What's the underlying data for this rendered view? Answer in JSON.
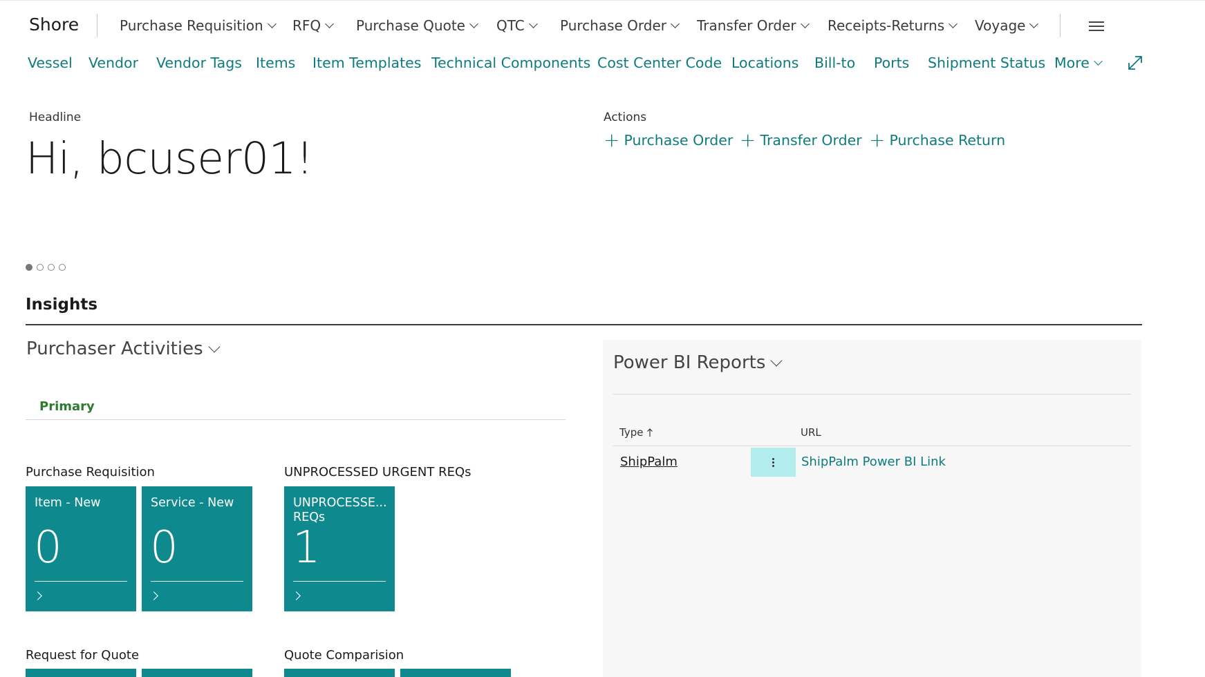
{
  "app": {
    "title": "Shore"
  },
  "nav": {
    "items": [
      {
        "label": "Purchase Requisition"
      },
      {
        "label": "RFQ"
      },
      {
        "label": "Purchase Quote"
      },
      {
        "label": "QTC"
      },
      {
        "label": "Purchase Order"
      },
      {
        "label": "Transfer Order"
      },
      {
        "label": "Receipts-Returns"
      },
      {
        "label": "Voyage"
      }
    ],
    "menu_icon": "hamburger-icon"
  },
  "subnav": {
    "items": [
      {
        "label": "Vessel"
      },
      {
        "label": "Vendor"
      },
      {
        "label": "Vendor Tags"
      },
      {
        "label": "Items"
      },
      {
        "label": "Item Templates"
      },
      {
        "label": "Technical Components"
      },
      {
        "label": "Cost Center Code"
      },
      {
        "label": "Locations"
      },
      {
        "label": "Bill-to"
      },
      {
        "label": "Ports"
      },
      {
        "label": "Shipment Status"
      }
    ],
    "more_label": "More",
    "expand_icon": "expand-icon"
  },
  "headline": {
    "label": "Headline",
    "greeting": "Hi, bcuser01!"
  },
  "actions": {
    "label": "Actions",
    "items": [
      {
        "label": "Purchase Order"
      },
      {
        "label": "Transfer Order"
      },
      {
        "label": "Purchase Return"
      }
    ]
  },
  "carousel": {
    "count": 4,
    "active": 1
  },
  "insights": {
    "title": "Insights"
  },
  "purchaser": {
    "title": "Purchaser Activities",
    "tab": "Primary",
    "groups": [
      {
        "label": "Purchase Requisition",
        "tiles": [
          {
            "label": "Item - New",
            "value": "0"
          },
          {
            "label": "Service - New",
            "value": "0"
          }
        ]
      },
      {
        "label": "UNPROCESSED URGENT REQs",
        "tiles": [
          {
            "label": "UNPROCESSE... REQs",
            "value": "1"
          }
        ]
      },
      {
        "label": "Request for Quote"
      },
      {
        "label": "Quote Comparision"
      }
    ]
  },
  "powerbi": {
    "title": "Power BI Reports",
    "columns": {
      "type": "Type",
      "url": "URL"
    },
    "sort_icon": "arrow-up-icon",
    "rows": [
      {
        "type": "ShipPalm",
        "url": "ShipPalm Power BI Link"
      }
    ]
  },
  "colors": {
    "accent": "#0d7b7f",
    "tile": "#0e8a8e",
    "primary_tab": "#2f7a2f",
    "selection": "#b3eced"
  }
}
